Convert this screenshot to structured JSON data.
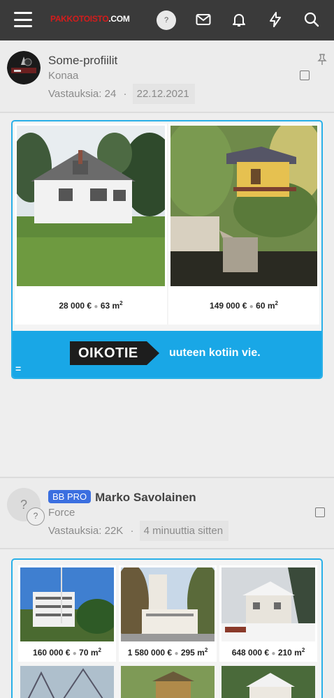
{
  "header": {
    "logo_red": "PAKKOTOISTO",
    "logo_white": ".COM",
    "help_label": "?",
    "icons": [
      "menu-icon",
      "help-icon",
      "mail-icon",
      "bell-icon",
      "bolt-icon",
      "search-icon"
    ]
  },
  "thread1": {
    "title": "Some-profiilit",
    "forum": "Konaa",
    "replies": "Vastauksia: 24",
    "separator": "·",
    "date": "22.12.2021",
    "pinned": true
  },
  "ad1": {
    "listings": [
      {
        "price": "28 000 €",
        "area": "63 m",
        "sup": "2"
      },
      {
        "price": "149 000 €",
        "area": "60 m",
        "sup": "2"
      }
    ],
    "brand": "OIKOTIE",
    "slogan": "uuteen kotiin vie.",
    "corner_mark": "="
  },
  "thread2": {
    "badge": "BB PRO",
    "author": "Marko Savolainen",
    "forum": "Force",
    "replies": "Vastauksia: 22K",
    "separator": "·",
    "date": "4 minuuttia sitten",
    "avatar_text": "?"
  },
  "ad2": {
    "listings": [
      {
        "price": "160 000 €",
        "area": "70 m",
        "sup": "2"
      },
      {
        "price": "1 580 000 €",
        "area": "295 m",
        "sup": "2"
      },
      {
        "price": "648 000 €",
        "area": "210 m",
        "sup": "2"
      }
    ]
  },
  "colors": {
    "topbar": "#3a3a3a",
    "accent_blue": "#19a7e6",
    "badge_blue": "#3b6fe0",
    "logo_red": "#d41c1c"
  }
}
